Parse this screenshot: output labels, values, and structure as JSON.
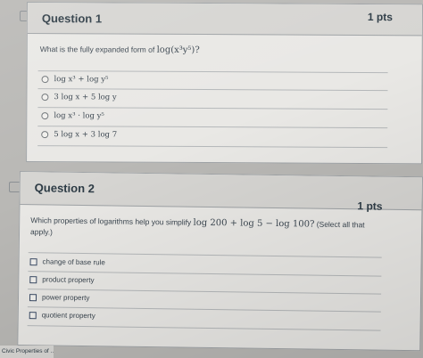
{
  "q1": {
    "title": "Question 1",
    "points": "1 pts",
    "prompt": "What is the fully expanded form of",
    "prompt_math": "log(x³y⁵)?",
    "options": [
      "log x³ + log y⁵",
      "3 log x + 5 log y",
      "log x³ · log y⁵",
      "5 log x + 3 log 7"
    ]
  },
  "q2": {
    "title": "Question 2",
    "points": "1 pts",
    "prompt_line1": "Which properties of logarithms help you simplify",
    "prompt_math": "log 200 + log 5 − log 100?",
    "prompt_after": "(Select all that",
    "prompt_line2": "apply.)",
    "options": [
      "change of base rule",
      "product property",
      "power property",
      "quotient property"
    ]
  },
  "footer": {
    "tab_label": "Civic Properties of ..."
  }
}
